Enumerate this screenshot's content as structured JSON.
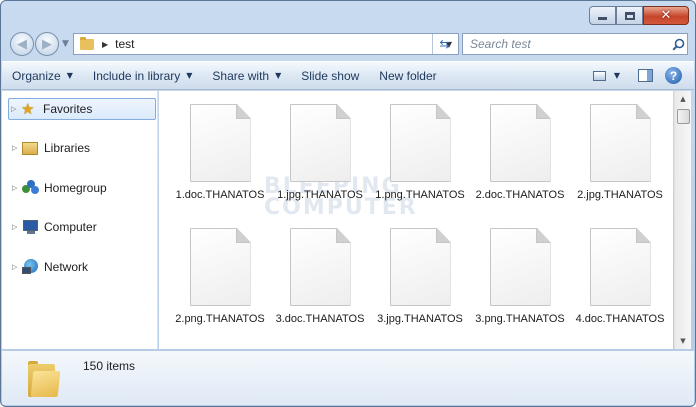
{
  "window": {
    "path_folder": "test",
    "search_placeholder": "Search test"
  },
  "toolbar": {
    "organize": "Organize",
    "include_in_library": "Include in library",
    "share_with": "Share with",
    "slide_show": "Slide show",
    "new_folder": "New folder"
  },
  "sidebar": {
    "items": [
      {
        "label": "Favorites",
        "icon": "star-icon",
        "selected": true
      },
      {
        "label": "Libraries",
        "icon": "libraries-icon"
      },
      {
        "label": "Homegroup",
        "icon": "homegroup-icon"
      },
      {
        "label": "Computer",
        "icon": "computer-icon"
      },
      {
        "label": "Network",
        "icon": "network-icon"
      }
    ]
  },
  "watermark": {
    "line1": "BLEEPING",
    "line2": "COMPUTER"
  },
  "files": [
    "1.doc.THANATOS",
    "1.jpg.THANATOS",
    "1.png.THANATOS",
    "2.doc.THANATOS",
    "2.jpg.THANATOS",
    "2.png.THANATOS",
    "3.doc.THANATOS",
    "3.jpg.THANATOS",
    "3.png.THANATOS",
    "4.doc.THANATOS"
  ],
  "details": {
    "item_count": "150 items"
  },
  "colors": {
    "frame": "#b3cbe6",
    "command_bar_text": "#1e395b",
    "selection_border": "#84acdd"
  }
}
